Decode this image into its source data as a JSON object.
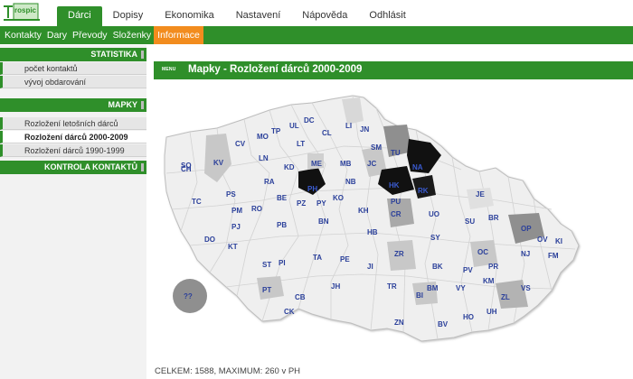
{
  "top_nav": {
    "tabs": [
      {
        "label": "Dárci",
        "active": true
      },
      {
        "label": "Dopisy",
        "active": false
      },
      {
        "label": "Ekonomika",
        "active": false
      },
      {
        "label": "Nastavení",
        "active": false
      },
      {
        "label": "Nápověda",
        "active": false
      },
      {
        "label": "Odhlásit",
        "active": false
      }
    ]
  },
  "sub_nav": {
    "tabs": [
      {
        "label": "Kontakty",
        "active": false
      },
      {
        "label": "Dary",
        "active": false
      },
      {
        "label": "Převody",
        "active": false
      },
      {
        "label": "Složenky",
        "active": false
      },
      {
        "label": "Informace",
        "active": true
      }
    ]
  },
  "sidebar": {
    "sections": [
      {
        "label": "STATISTIKA",
        "items": [
          "počet kontaktů",
          "vývoj obdarování"
        ]
      },
      {
        "label": "MAPKY",
        "items": [
          "Rozložení letošních dárců",
          "Rozložení dárců 2000-2009",
          "Rozložení dárců 1990-1999"
        ]
      },
      {
        "label": "KONTROLA KONTAKTŮ",
        "items": []
      }
    ]
  },
  "content": {
    "menu_label": "MENU",
    "title": "Mapky - Rozložení dárců 2000-2009",
    "footer": "CELKEM: 1588, MAXIMUM: 260 v PH",
    "unknown_label": "??"
  },
  "colors": {
    "brand_green": "#2f8f2a",
    "accent_orange": "#f28c1e",
    "code_blue": "#2a3f9a",
    "region_light": "#efefef",
    "region_mid": "#c8c8c8",
    "region_dark": "#8f8f8f",
    "region_black": "#111111"
  },
  "districts": [
    {
      "code": "SO"
    },
    {
      "code": "KV"
    },
    {
      "code": "CV"
    },
    {
      "code": "MO"
    },
    {
      "code": "TP"
    },
    {
      "code": "UL"
    },
    {
      "code": "DC"
    },
    {
      "code": "CL"
    },
    {
      "code": "LI"
    },
    {
      "code": "JN"
    },
    {
      "code": "SM"
    },
    {
      "code": "TU"
    },
    {
      "code": "NA"
    },
    {
      "code": "JC"
    },
    {
      "code": "LN"
    },
    {
      "code": "LT"
    },
    {
      "code": "MB"
    },
    {
      "code": "RA"
    },
    {
      "code": "KD"
    },
    {
      "code": "ME"
    },
    {
      "code": "CH"
    },
    {
      "code": "BE"
    },
    {
      "code": "PH"
    },
    {
      "code": "NB"
    },
    {
      "code": "HK"
    },
    {
      "code": "RK"
    },
    {
      "code": "PS"
    },
    {
      "code": "PZ"
    },
    {
      "code": "PY"
    },
    {
      "code": "KO"
    },
    {
      "code": "TC"
    },
    {
      "code": "PM"
    },
    {
      "code": "RO"
    },
    {
      "code": "KH"
    },
    {
      "code": "PU"
    },
    {
      "code": "CR"
    },
    {
      "code": "UO"
    },
    {
      "code": "SU"
    },
    {
      "code": "BR"
    },
    {
      "code": "JE"
    },
    {
      "code": "OP"
    },
    {
      "code": "OV"
    },
    {
      "code": "KI"
    },
    {
      "code": "PJ"
    },
    {
      "code": "PB"
    },
    {
      "code": "BN"
    },
    {
      "code": "HB"
    },
    {
      "code": "SY"
    },
    {
      "code": "DO"
    },
    {
      "code": "KT"
    },
    {
      "code": "PI"
    },
    {
      "code": "TA"
    },
    {
      "code": "PE"
    },
    {
      "code": "ZR"
    },
    {
      "code": "OC"
    },
    {
      "code": "NJ"
    },
    {
      "code": "FM"
    },
    {
      "code": "ST"
    },
    {
      "code": "PT"
    },
    {
      "code": "JI"
    },
    {
      "code": "BK"
    },
    {
      "code": "PV"
    },
    {
      "code": "PR"
    },
    {
      "code": "KM"
    },
    {
      "code": "VS"
    },
    {
      "code": "PT"
    },
    {
      "code": "CB"
    },
    {
      "code": "JH"
    },
    {
      "code": "TR"
    },
    {
      "code": "BM"
    },
    {
      "code": "BI"
    },
    {
      "code": "VY"
    },
    {
      "code": "ZL"
    },
    {
      "code": "UH"
    },
    {
      "code": "CK"
    },
    {
      "code": "ZN"
    },
    {
      "code": "BV"
    },
    {
      "code": "HO"
    }
  ]
}
